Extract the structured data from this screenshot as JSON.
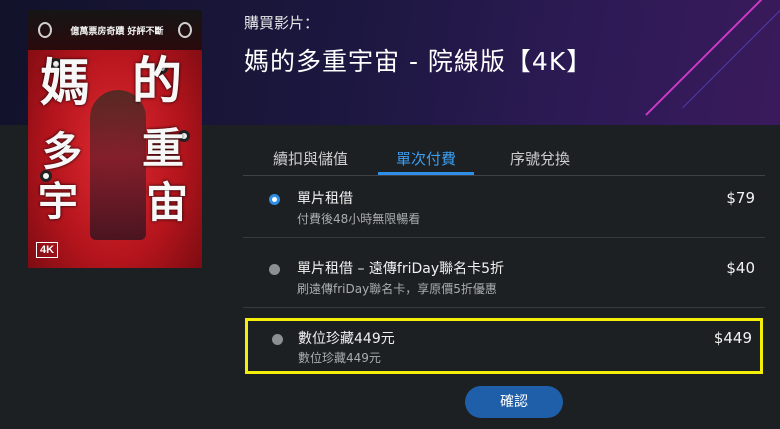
{
  "header": {
    "buy_label": "購買影片：",
    "movie_title": "媽的多重宇宙 - 院線版【4K】"
  },
  "poster": {
    "tagline": "億萬票房奇蹟 好評不斷",
    "title_chars": [
      "媽",
      "的",
      "多",
      "重",
      "宇",
      "宙"
    ],
    "badge": "4K"
  },
  "tabs": [
    {
      "label": "續扣與儲值",
      "active": false
    },
    {
      "label": "單次付費",
      "active": true
    },
    {
      "label": "序號兌換",
      "active": false
    }
  ],
  "options": [
    {
      "title": "單片租借",
      "subtitle": "付費後48小時無限暢看",
      "price": "$79",
      "selected": true
    },
    {
      "title": "單片租借 – 遠傳friDay聯名卡5折",
      "subtitle": "刷遠傳friDay聯名卡，享原價5折優惠",
      "price": "$40",
      "selected": false
    },
    {
      "title": "數位珍藏449元",
      "subtitle": "數位珍藏449元",
      "price": "$449",
      "selected": false
    }
  ],
  "confirm_label": "確認",
  "colors": {
    "accent": "#2f8fe6",
    "highlight": "#f5ee08",
    "button": "#1f5fa9"
  }
}
